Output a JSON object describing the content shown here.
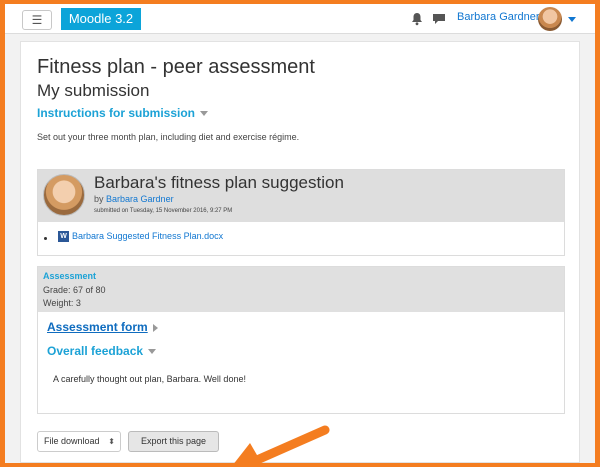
{
  "navbar": {
    "menu_icon": "hamburger-icon",
    "menu_glyph": "☰",
    "brand": "Moodle 3.2",
    "icons": [
      "bell-icon",
      "chat-icon"
    ],
    "user_name": "Barbara Gardner"
  },
  "page": {
    "title": "Fitness plan - peer assessment",
    "subtitle": "My submission",
    "instructions_link": "Instructions for submission",
    "instructions_text": "Set out your three month plan, including diet and exercise régime."
  },
  "submission": {
    "title": "Barbara's fitness plan suggestion",
    "by_prefix": "by",
    "author": "Barbara Gardner",
    "submitted_on": "submitted on Tuesday, 15 November 2016, 9:27 PM",
    "file_icon": "word-document-icon",
    "file_name": "Barbara Suggested Fitness Plan.docx"
  },
  "assessment": {
    "label": "Assessment",
    "grade": "Grade: 67 of 80",
    "weight": "Weight: 3",
    "form_link": "Assessment form",
    "overall_feedback": "Overall feedback",
    "feedback_text": "A carefully thought out plan, Barbara. Well done!"
  },
  "footer": {
    "download_select": "File download",
    "export_button": "Export this page"
  },
  "colors": {
    "frame": "#f47d20",
    "brand": "#0ca4d9",
    "link": "#1177d1",
    "heading_link": "#1ca2d6",
    "arrow": "#f47d20"
  }
}
